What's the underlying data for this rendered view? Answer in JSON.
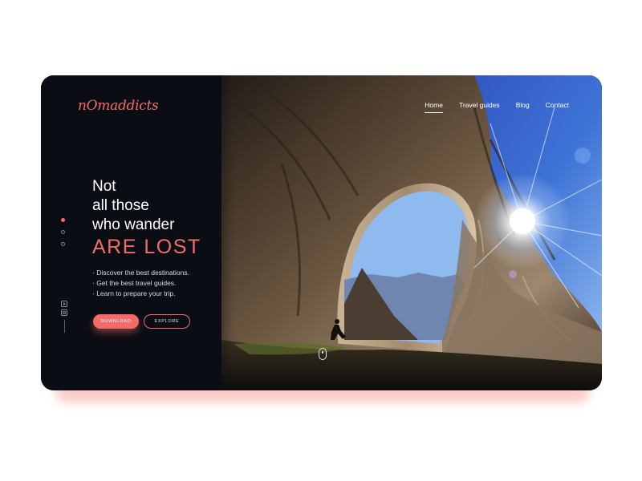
{
  "brand": {
    "logo": "nOmaddicts",
    "accent_color": "#f26d6a"
  },
  "nav": {
    "items": [
      {
        "label": "Home",
        "active": true
      },
      {
        "label": "Travel guides",
        "active": false
      },
      {
        "label": "Blog",
        "active": false
      },
      {
        "label": "Contact",
        "active": false
      }
    ]
  },
  "hero": {
    "line1": "Not",
    "line2": "all those",
    "line3": "who wander",
    "accent": "ARE LOST",
    "bullets": [
      "· Discover the best destinations.",
      "· Get the best travel guides.",
      "· Learn to prepare your trip."
    ],
    "buttons": {
      "download": "DOWNLOAD",
      "explore": "EXPLORE"
    }
  },
  "slider": {
    "count": 3,
    "active": 1
  },
  "socials": {
    "icons": [
      "youtube-icon",
      "instagram-icon"
    ]
  },
  "scroll": {
    "icon": "mouse-scroll-icon"
  }
}
